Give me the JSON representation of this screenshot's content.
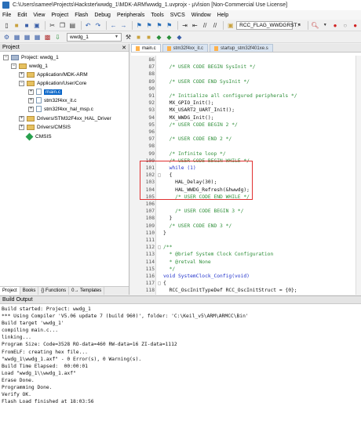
{
  "window": {
    "title": "C:\\Users\\samee\\Projects\\Hackster\\wwdg_1\\MDK-ARM\\wwdg_1.uvprojx - µVision  [Non-Commercial Use License]"
  },
  "menu": [
    "File",
    "Edit",
    "View",
    "Project",
    "Flash",
    "Debug",
    "Peripherals",
    "Tools",
    "SVCS",
    "Window",
    "Help"
  ],
  "toolbar": {
    "find_combo": "RCC_FLAG_WWDGRST",
    "target_combo": "wwdg_1"
  },
  "project_panel": {
    "title": "Project",
    "tree": [
      {
        "label": "Project: wwdg_1",
        "exp": "−",
        "icon": "project"
      },
      {
        "label": "wwdg_1",
        "exp": "−",
        "icon": "folder"
      },
      {
        "label": "Application/MDK-ARM",
        "exp": "+",
        "icon": "folder"
      },
      {
        "label": "Application/User/Core",
        "exp": "−",
        "icon": "folder"
      },
      {
        "label": "main.c",
        "exp": "+",
        "icon": "file",
        "selected": true
      },
      {
        "label": "stm32f4xx_it.c",
        "exp": "+",
        "icon": "file"
      },
      {
        "label": "stm32f4xx_hal_msp.c",
        "exp": "+",
        "icon": "file"
      },
      {
        "label": "Drivers/STM32F4xx_HAL_Driver",
        "exp": "+",
        "icon": "folder"
      },
      {
        "label": "Drivers/CMSIS",
        "exp": "+",
        "icon": "folder"
      },
      {
        "label": "CMSIS",
        "exp": "",
        "icon": "gem"
      }
    ],
    "tabs": [
      "Project",
      "Books",
      "{} Functions",
      "0→ Templates"
    ]
  },
  "editor": {
    "tabs": [
      {
        "label": "main.c",
        "active": true
      },
      {
        "label": "stm32f4xx_it.c",
        "active": false
      },
      {
        "label": "startup_stm32f401xe.s",
        "active": false
      }
    ],
    "lines": [
      {
        "n": "86",
        "fm": "",
        "t": "",
        "c": "tx"
      },
      {
        "n": "87",
        "fm": "",
        "t": "  /* USER CODE BEGIN SysInit */",
        "c": "cm"
      },
      {
        "n": "88",
        "fm": "",
        "t": "",
        "c": "tx"
      },
      {
        "n": "89",
        "fm": "",
        "t": "  /* USER CODE END SysInit */",
        "c": "cm"
      },
      {
        "n": "90",
        "fm": "",
        "t": "",
        "c": "tx"
      },
      {
        "n": "91",
        "fm": "",
        "t": "  /* Initialize all configured peripherals */",
        "c": "cm"
      },
      {
        "n": "92",
        "fm": "",
        "t": "  MX_GPIO_Init();",
        "c": "tx"
      },
      {
        "n": "93",
        "fm": "",
        "t": "  MX_USART2_UART_Init();",
        "c": "tx"
      },
      {
        "n": "94",
        "fm": "",
        "t": "  MX_WWDG_Init();",
        "c": "tx"
      },
      {
        "n": "95",
        "fm": "",
        "t": "  /* USER CODE BEGIN 2 */",
        "c": "cm"
      },
      {
        "n": "96",
        "fm": "",
        "t": "",
        "c": "tx"
      },
      {
        "n": "97",
        "fm": "",
        "t": "  /* USER CODE END 2 */",
        "c": "cm"
      },
      {
        "n": "98",
        "fm": "",
        "t": "",
        "c": "tx"
      },
      {
        "n": "99",
        "fm": "",
        "t": "  /* Infinite loop */",
        "c": "cm"
      },
      {
        "n": "100",
        "fm": "",
        "t": "  /* USER CODE BEGIN WHILE */",
        "c": "cm"
      },
      {
        "n": "101",
        "fm": "",
        "t": "  while (1)",
        "c": "kw"
      },
      {
        "n": "102",
        "fm": "□",
        "t": "  {",
        "c": "tx"
      },
      {
        "n": "103",
        "fm": "",
        "t": "    HAL_Delay(30);",
        "c": "tx"
      },
      {
        "n": "104",
        "fm": "",
        "t": "    HAL_WWDG_Refresh(&hwwdg);",
        "c": "tx"
      },
      {
        "n": "105",
        "fm": "",
        "t": "    /* USER CODE END WHILE */",
        "c": "cm"
      },
      {
        "n": "106",
        "fm": "",
        "t": "",
        "c": "tx"
      },
      {
        "n": "107",
        "fm": "",
        "t": "    /* USER CODE BEGIN 3 */",
        "c": "cm"
      },
      {
        "n": "108",
        "fm": "",
        "t": "  }",
        "c": "tx"
      },
      {
        "n": "109",
        "fm": "",
        "t": "  /* USER CODE END 3 */",
        "c": "cm"
      },
      {
        "n": "110",
        "fm": "",
        "t": "}",
        "c": "tx"
      },
      {
        "n": "111",
        "fm": "",
        "t": "",
        "c": "tx"
      },
      {
        "n": "112",
        "fm": "□",
        "t": "/**",
        "c": "cm"
      },
      {
        "n": "113",
        "fm": "",
        "t": "  * @brief System Clock Configuration",
        "c": "cm"
      },
      {
        "n": "114",
        "fm": "",
        "t": "  * @retval None",
        "c": "cm"
      },
      {
        "n": "115",
        "fm": "",
        "t": "  */",
        "c": "cm"
      },
      {
        "n": "116",
        "fm": "",
        "t": "void SystemClock_Config(void)",
        "c": "kw"
      },
      {
        "n": "117",
        "fm": "□",
        "t": "{",
        "c": "tx"
      },
      {
        "n": "118",
        "fm": "",
        "t": "  RCC_OscInitTypeDef RCC_OscInitStruct = {0};",
        "c": "tx"
      },
      {
        "n": "119",
        "fm": "",
        "t": "  RCC_ClkInitTypeDef RCC_ClkInitStruct = {0};",
        "c": "tx"
      }
    ]
  },
  "build_output": {
    "title": "Build Output",
    "lines": [
      "Build started: Project: wwdg_1",
      "*** Using Compiler 'V5.06 update 7 (build 960)', folder: 'C:\\Keil_v5\\ARM\\ARMCC\\Bin'",
      "Build target 'wwdg_1'",
      "compiling main.c...",
      "linking...",
      "Program Size: Code=3528 RO-data=460 RW-data=16 ZI-data=1112",
      "FromELF: creating hex file...",
      "\"wwdg_1\\wwdg_1.axf\" - 0 Error(s), 0 Warning(s).",
      "Build Time Elapsed:  00:00:01",
      "Load \"wwdg_1\\\\wwdg_1.axf\"",
      "Erase Done.",
      "Programming Done.",
      "Verify OK.",
      "Flash Load finished at 18:03:56"
    ]
  },
  "colors": {
    "comment": "#2f8f3a",
    "keyword": "#2233cc",
    "selection": "#0a66c8",
    "highlight_box": "#e03030"
  }
}
